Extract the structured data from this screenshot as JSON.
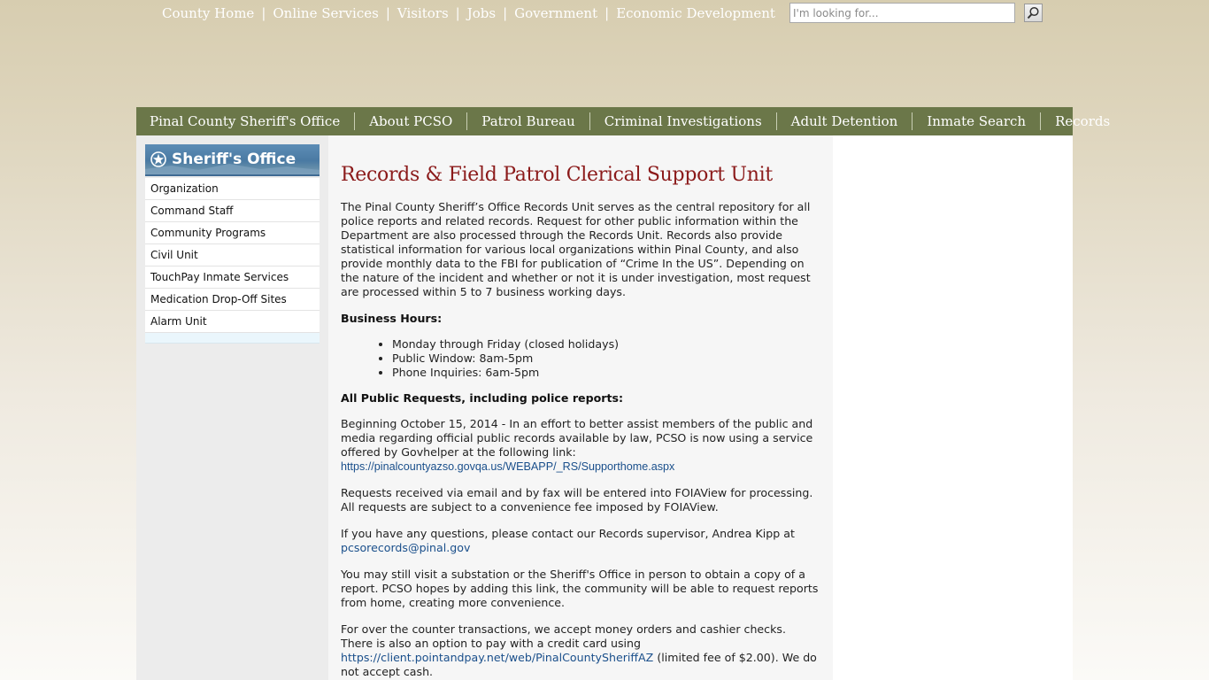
{
  "topnav": {
    "links": [
      "County Home",
      "Online Services",
      "Visitors",
      "Jobs",
      "Government",
      "Economic Development"
    ]
  },
  "search": {
    "placeholder": "I'm looking for...",
    "button_icon": "search-icon"
  },
  "mainnav": {
    "items": [
      "Pinal County Sheriff's Office",
      "About PCSO",
      "Patrol Bureau",
      "Criminal Investigations",
      "Adult Detention",
      "Inmate Search",
      "Records"
    ]
  },
  "sidebar": {
    "title": "Sheriff's Office",
    "title_icon": "star-badge-icon",
    "items": [
      "Organization",
      "Command Staff",
      "Community Programs",
      "Civil Unit",
      "TouchPay Inmate Services",
      "Medication Drop-Off Sites",
      "Alarm Unit"
    ]
  },
  "content": {
    "title": "Records & Field Patrol Clerical Support Unit",
    "intro": "The Pinal County Sheriff’s Office Records Unit serves as the central repository for all police reports and related records. Request for other public information within the Department are also processed through the Records Unit. Records also provide statistical information for various local organizations within Pinal County, and also provide monthly data to the FBI for publication of “Crime In the US”. Depending on the nature of the incident and whether or not it is under investigation, most request are processed within 5 to 7 business working days.",
    "hours_heading": "Business Hours:",
    "hours": [
      "Monday through Friday (closed holidays)",
      "Public Window: 8am-5pm",
      "Phone Inquiries: 6am-5pm"
    ],
    "requests_heading": "All Public Requests, including police reports:",
    "requests_text": "Beginning October 15, 2014 - In an effort to better assist members of the public and media regarding official public records available by law, PCSO is now using a service offered by Govhelper at the following link: ",
    "requests_link": "https://pinalcountyazso.govqa.us/WEBAPP/_RS/Supporthome.aspx",
    "foia_text": "Requests received via email and by fax will be entered into FOIAView for processing.  All requests are subject to a convenience fee imposed by FOIAView.",
    "questions_text": "If you have any questions, please contact our Records supervisor, Andrea Kipp at ",
    "questions_email": "pcsorecords@pinal.gov",
    "visit_text": "You may still visit a substation or the Sheriff's Office in person to obtain a copy of a report.  PCSO hopes by adding this link, the community will be able to request reports from home, creating more convenience.",
    "counter_text_1": "For over the counter transactions, we accept money orders and cashier checks. There is also an option to pay with a credit card using ",
    "counter_link": "https://client.pointandpay.net/web/PinalCountySheriffAZ",
    "counter_text_2": " (limited fee of $2.00). We do not accept cash."
  },
  "colors": {
    "nav_green": "#6b7749",
    "title_red": "#8b1a1a",
    "link_blue": "#1a4f8b",
    "sidebar_blue": "#4a7aa3"
  }
}
